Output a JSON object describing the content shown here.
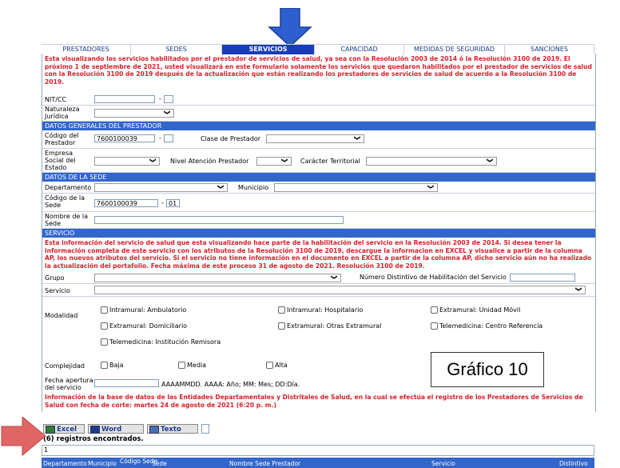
{
  "tabs": [
    "PRESTADORES",
    "SEDES",
    "SERVICIOS",
    "CAPACIDAD",
    "MEDIDAS DE SEGURIDAD",
    "SANCIONES"
  ],
  "notice_top": "Esta visualizando los servicios habilitados por el prestador de servicios de salud, ya sea con la Resolución 2003 de 2014 ó la Resolución 3100 de 2019. El próximo 1 de septiembre de 2021, usted visualizará en este formulario solamente los servicios que quedaron habilitados por el prestador de servicios de salud con la Resolución 3100 de 2019 después de la actualización que están realizando los prestadores de servicios de salud de acuerdo a la Resolución 3100 de 2019.",
  "nit_label": "NIT/CC",
  "nit_sep": "-",
  "naturaleza_label": "Naturaleza Jurídica",
  "sec_general": "DATOS GENERALES DEL PRESTADOR",
  "codigo_prestador_label": "Código del Prestador",
  "codigo_prestador_value": "7600100039",
  "clase_label": "Clase de Prestador",
  "empresa_label": "Empresa Social del Estado",
  "nivel_label": "Nivel Atención Prestador",
  "caracter_label": "Carácter Territorial",
  "sec_sede": "DATOS DE LA SEDE",
  "departamento_label": "Departamento",
  "municipio_label": "Municipio",
  "codigo_sede_label": "Código de la Sede",
  "codigo_sede_value": "7600100039",
  "codigo_sede_suffix": "01",
  "nombre_sede_label": "Nombre de la Sede",
  "sec_servicio": "SERVICIO",
  "notice_servicio": "Esta información del servicio de salud que esta visualizando hace parte de la habilitación del servicio en la Resolución 2003 de 2014. Si desea tener la información completa de este servicio con los atributos de la Resolución 3100 de 2019, descargue la informacion en EXCEL y visualice a partir de la columna AP, los nuevos atributos del servicio. Si el servicio no tiene información en el documento en EXCEL a partir de la columna AP, dicho servicio aún no ha realizado la actualización del portafolio. Fecha máxima de este proceso 31 de agosto de 2021. Resolución 3100 de 2019.",
  "grupo_label": "Grupo",
  "numero_label": "Número Distintivo de Habilitación del Servicio",
  "servicio_label": "Servicio",
  "modalidad_label": "Modalidad",
  "modalidades": [
    "Intramural: Ambulatorio",
    "Intramural: Hospitalario",
    "Extramural: Unidad Móvil",
    "Extramural: Domiciliario",
    "Extramural: Otras Extramural",
    "Telemedicina: Centro Referencia",
    "Telemedicina: Institución Remisora"
  ],
  "complejidad_label": "Complejidad",
  "complejidades": [
    "Baja",
    "Media",
    "Alta"
  ],
  "fecha_label": "Fecha apertura del servicio",
  "fecha_hint": "AAAAMMDD. AAAA: Año; MM: Mes; DD:Día.",
  "grafico": "Gráfico 10",
  "info_base": "Información de la base de datos de las Entidades Departamentales y Distritales de Salud, en la cual se efectúa el registro de los Prestadores de Servicios de Salud con fecha de corte: martes 24 de agosto de 2021 (6:20 p. m.)",
  "buttons": [
    "Excel",
    "Word",
    "Texto"
  ],
  "registros": "(6) registros encontrados.",
  "page_num": "1",
  "columns": [
    "Departamento",
    "Municipio",
    "Código Sede",
    "Sede",
    "Nombre Sede Prestador",
    "Servicio",
    "Distintivo"
  ],
  "colors": {
    "accent": "#3366cc",
    "tab_active": "#1a3cb8",
    "notice": "#d61f2c",
    "arrow_blue": "#2d5fd0",
    "arrow_red": "#e06666"
  }
}
